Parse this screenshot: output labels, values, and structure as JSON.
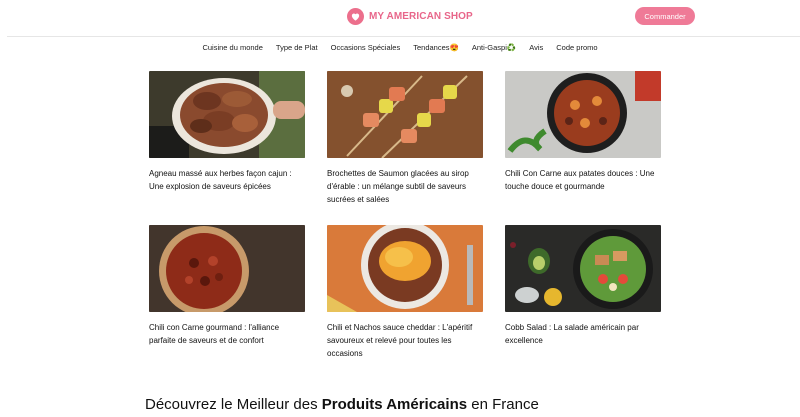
{
  "header": {
    "brand": "MY AMERICAN SHOP",
    "cta_label": "Commander"
  },
  "nav": {
    "items": [
      {
        "label": "Cuisine du monde"
      },
      {
        "label": "Type de Plat"
      },
      {
        "label": "Occasions Spéciales"
      },
      {
        "label": "Tendances😍"
      },
      {
        "label": "Anti-Gaspi♻️"
      },
      {
        "label": "Avis"
      },
      {
        "label": "Code promo"
      }
    ]
  },
  "recipes": [
    {
      "title": "Agneau massé aux herbes façon cajun : Une explosion de saveurs épicées"
    },
    {
      "title": "Brochettes de Saumon glacées au sirop d'érable : un mélange subtil de saveurs sucrées et salées"
    },
    {
      "title": "Chili Con Carne aux patates douces : Une touche douce et gourmande"
    },
    {
      "title": "Chili con Carne gourmand : l'alliance parfaite de saveurs et de confort"
    },
    {
      "title": "Chili et Nachos sauce cheddar : L'apéritif savoureux et relevé pour toutes les occasions"
    },
    {
      "title": "Cobb Salad : La salade américain par excellence"
    }
  ],
  "footer": {
    "heading_prefix": "Découvrez le Meilleur des ",
    "heading_bold": "Produits Américains",
    "heading_suffix": " en France"
  },
  "colors": {
    "brand_pink": "#e8668a",
    "cta_pink": "#ef7a97"
  }
}
